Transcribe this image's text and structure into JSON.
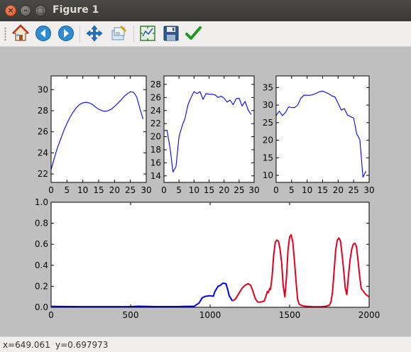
{
  "window": {
    "title": "Figure 1"
  },
  "window_buttons": {
    "close": "×",
    "minimize": "–",
    "maximize": "□"
  },
  "toolbar": {
    "buttons": [
      {
        "name": "home-icon",
        "tooltip": "Home"
      },
      {
        "name": "back-arrow-icon",
        "tooltip": "Back"
      },
      {
        "name": "forward-arrow-icon",
        "tooltip": "Forward"
      },
      {
        "name": "pan-icon",
        "tooltip": "Pan"
      },
      {
        "name": "zoom-icon",
        "tooltip": "Zoom"
      },
      {
        "name": "subplots-icon",
        "tooltip": "Subplots"
      },
      {
        "name": "save-icon",
        "tooltip": "Save"
      },
      {
        "name": "check-icon",
        "tooltip": "Edit"
      }
    ]
  },
  "statusbar": {
    "x": "x=649.061",
    "y": "y=0.697973"
  },
  "colors": {
    "series_blue": "#0000ff",
    "series_red": "#e3001b",
    "canvas_bg": "#bfbfbf",
    "axes_bg": "#ffffff"
  },
  "chart_data": [
    {
      "type": "line",
      "xlim": [
        0,
        30
      ],
      "ylim": [
        21.2,
        31.3
      ],
      "xticks": [
        0,
        5,
        10,
        15,
        20,
        25,
        30
      ],
      "yticks": [
        22,
        24,
        26,
        28,
        30
      ],
      "series": [
        {
          "color": "#0000ff",
          "x": [
            0,
            1,
            2,
            3,
            4,
            5,
            6,
            7,
            8,
            9,
            10,
            11,
            12,
            13,
            14,
            15,
            16,
            17,
            18,
            19,
            20,
            21,
            22,
            23,
            24,
            25,
            26,
            27,
            28,
            29
          ],
          "y": [
            22.4,
            23.5,
            24.5,
            25.3,
            26.1,
            26.8,
            27.4,
            27.9,
            28.3,
            28.6,
            28.75,
            28.8,
            28.75,
            28.6,
            28.35,
            28.15,
            28.0,
            27.95,
            28.0,
            28.15,
            28.4,
            28.7,
            29.0,
            29.35,
            29.6,
            29.8,
            29.75,
            29.3,
            28.2,
            27.2
          ]
        }
      ]
    },
    {
      "type": "line",
      "xlim": [
        0,
        30
      ],
      "ylim": [
        13.0,
        29.3
      ],
      "xticks": [
        0,
        5,
        10,
        15,
        20,
        25,
        30
      ],
      "yticks": [
        14,
        16,
        18,
        20,
        22,
        24,
        26,
        28
      ],
      "series": [
        {
          "color": "#0000ff",
          "x": [
            0,
            1,
            2,
            3,
            4,
            5,
            6,
            7,
            8,
            9,
            10,
            11,
            12,
            13,
            14,
            15,
            16,
            17,
            18,
            19,
            20,
            21,
            22,
            23,
            24,
            25,
            26,
            27,
            28,
            29
          ],
          "y": [
            20.9,
            21.0,
            18.3,
            14.6,
            15.4,
            20.0,
            21.6,
            22.8,
            24.9,
            26.0,
            26.9,
            26.6,
            26.9,
            25.7,
            26.6,
            26.5,
            26.5,
            26.4,
            26.0,
            26.2,
            25.9,
            25.3,
            25.6,
            24.9,
            25.8,
            25.9,
            24.7,
            25.4,
            24.1,
            23.4
          ]
        }
      ]
    },
    {
      "type": "line",
      "xlim": [
        0,
        30
      ],
      "ylim": [
        8.0,
        38.3
      ],
      "xticks": [
        0,
        5,
        10,
        15,
        20,
        25,
        30
      ],
      "yticks": [
        10,
        15,
        20,
        25,
        30,
        35
      ],
      "series": [
        {
          "color": "#0000ff",
          "x": [
            0,
            1,
            2,
            3,
            4,
            5,
            6,
            7,
            8,
            9,
            10,
            11,
            12,
            13,
            14,
            15,
            16,
            17,
            18,
            19,
            20,
            21,
            22,
            23,
            24,
            25,
            26,
            27,
            28,
            29
          ],
          "y": [
            27.0,
            28.3,
            27.0,
            27.9,
            29.5,
            29.3,
            29.3,
            30.1,
            32.0,
            32.8,
            32.8,
            32.8,
            33.0,
            33.4,
            33.8,
            34.0,
            33.6,
            33.2,
            32.6,
            32.3,
            30.5,
            28.6,
            29.0,
            27.2,
            26.7,
            26.3,
            21.8,
            20.2,
            9.5,
            11.2
          ]
        }
      ]
    },
    {
      "type": "line",
      "xlim": [
        0,
        2000
      ],
      "ylim": [
        0.0,
        1.0
      ],
      "xticks": [
        0,
        500,
        1000,
        1500,
        2000
      ],
      "yticks": [
        0.0,
        0.2,
        0.4,
        0.6,
        0.8,
        1.0
      ],
      "series": [
        {
          "color": "#0000ff",
          "x": [
            0,
            200,
            400,
            500,
            550,
            600,
            650,
            700,
            800,
            900,
            930,
            950,
            970,
            1000,
            1020,
            1030,
            1050,
            1065,
            1080,
            1100,
            1112,
            1120,
            1140
          ],
          "y": [
            0.008,
            0.006,
            0.006,
            0.007,
            0.01,
            0.009,
            0.007,
            0.007,
            0.007,
            0.01,
            0.04,
            0.09,
            0.105,
            0.11,
            0.105,
            0.15,
            0.2,
            0.21,
            0.23,
            0.225,
            0.16,
            0.11,
            0.06
          ]
        },
        {
          "color": "#e3001b",
          "x": [
            1140,
            1160,
            1180,
            1200,
            1220,
            1240,
            1255,
            1270,
            1285,
            1300,
            1320,
            1340,
            1350,
            1360,
            1365,
            1375,
            1380,
            1390,
            1400,
            1410,
            1420,
            1430,
            1440,
            1450,
            1460,
            1470,
            1480,
            1490,
            1500,
            1510,
            1520,
            1530,
            1540,
            1550,
            1560,
            1580,
            1600,
            1650,
            1700,
            1730,
            1750,
            1760,
            1770,
            1780,
            1790,
            1800,
            1810,
            1820,
            1830,
            1840,
            1850,
            1860,
            1870,
            1880,
            1890,
            1900,
            1910,
            1920,
            1930,
            1940,
            1950,
            1960,
            1970,
            1980,
            1990,
            2000
          ],
          "y": [
            0.06,
            0.08,
            0.13,
            0.18,
            0.21,
            0.225,
            0.21,
            0.15,
            0.08,
            0.05,
            0.05,
            0.06,
            0.1,
            0.15,
            0.14,
            0.18,
            0.17,
            0.3,
            0.5,
            0.62,
            0.64,
            0.63,
            0.55,
            0.42,
            0.2,
            0.1,
            0.28,
            0.55,
            0.67,
            0.69,
            0.62,
            0.45,
            0.25,
            0.08,
            0.03,
            0.015,
            0.01,
            0.005,
            0.005,
            0.01,
            0.02,
            0.05,
            0.15,
            0.35,
            0.55,
            0.64,
            0.66,
            0.63,
            0.5,
            0.35,
            0.18,
            0.12,
            0.3,
            0.45,
            0.55,
            0.6,
            0.61,
            0.58,
            0.45,
            0.3,
            0.18,
            0.16,
            0.14,
            0.12,
            0.11,
            0.1
          ]
        }
      ]
    }
  ]
}
